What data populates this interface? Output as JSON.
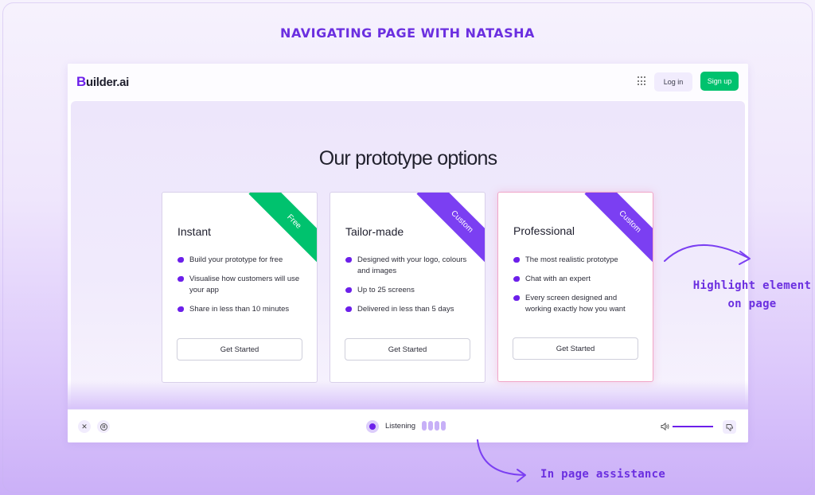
{
  "title": "NAVIGATING PAGE WITH NATASHA",
  "header": {
    "logo_initial": "B",
    "logo_rest": "uilder.ai",
    "login_label": "Log in",
    "signup_label": "Sign up"
  },
  "page": {
    "heading": "Our prototype options",
    "cards": [
      {
        "title": "Instant",
        "ribbon": "Free",
        "ribbon_color": "#00c26e",
        "features": [
          "Build your prototype for free",
          "Visualise how customers will use your app",
          "Share in less than 10 minutes"
        ],
        "button": "Get Started"
      },
      {
        "title": "Tailor-made",
        "ribbon": "Custom",
        "ribbon_color": "#7b3ff2",
        "features": [
          "Designed with your logo, colours and images",
          "Up to 25 screens",
          "Delivered in less than 5 days"
        ],
        "button": "Get Started"
      },
      {
        "title": "Professional",
        "ribbon": "Custom",
        "ribbon_color": "#7b3ff2",
        "features": [
          "The most realistic prototype",
          "Chat with an expert",
          "Every screen designed and working exactly how you want"
        ],
        "button": "Get Started"
      }
    ]
  },
  "assistant_bar": {
    "close_symbol": "✕",
    "status_label": "Listening"
  },
  "annotations": {
    "highlight_line1": "Highlight element",
    "highlight_line2": "on page",
    "assist": "In page assistance"
  },
  "colors": {
    "accent": "#6c1fea",
    "annotation": "#6b2fe0",
    "signup": "#00c26e"
  }
}
